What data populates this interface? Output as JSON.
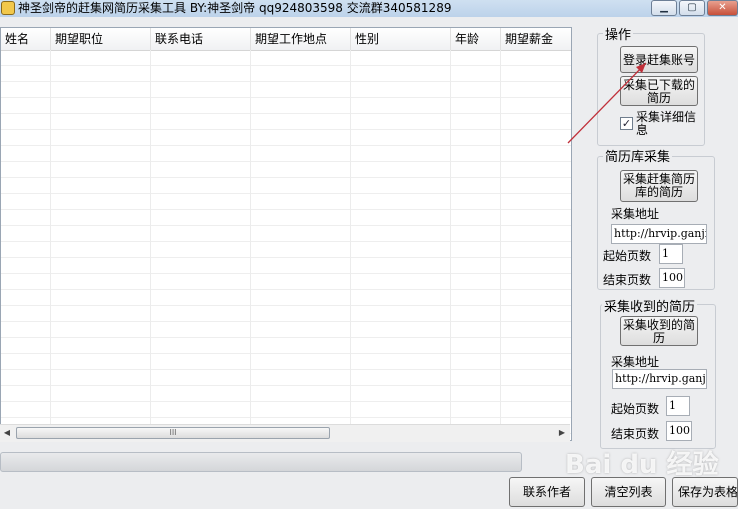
{
  "window": {
    "title": "神圣剑帝的赶集网简历采集工具 BY:神圣剑帝 qq924803598 交流群340581289",
    "controls": {
      "minimize": "▁",
      "maximize": "▢",
      "close": "✕"
    }
  },
  "grid": {
    "columns": [
      "姓名",
      "期望职位",
      "联系电话",
      "期望工作地点",
      "性别",
      "年龄",
      "期望薪金"
    ],
    "scroll_thumb_grip": "III",
    "scroll_left": "◀",
    "scroll_right": "▶"
  },
  "progress": {
    "value": 0
  },
  "panel_op": {
    "title": "操作",
    "login_button": "登录赶集账号",
    "collect_downloaded_line1": "采集已下载的",
    "collect_downloaded_line2": "简历",
    "detail_checkbox_line1": "采集详细信",
    "detail_checkbox_line2": "息",
    "detail_checked": true,
    "check_glyph": "✓"
  },
  "panel_library": {
    "title": "简历库采集",
    "collect_button_line1": "采集赶集简历",
    "collect_button_line2": "库的简历",
    "url_label": "采集地址",
    "url_value": "http://hrvip.ganji",
    "start_label": "起始页数",
    "start_value": "1",
    "end_label": "结束页数",
    "end_value": "100"
  },
  "panel_received": {
    "title": "采集收到的简历",
    "collect_button_line1": "采集收到的简",
    "collect_button_line2": "历",
    "url_label": "采集地址",
    "url_value": "http://hrvip.ganji",
    "start_label": "起始页数",
    "start_value": "1",
    "end_label": "结束页数",
    "end_value": "100"
  },
  "footer": {
    "contact_button": "联系作者",
    "clear_button": "清空列表",
    "save_button": "保存为表格"
  },
  "watermark": {
    "text": "Bai du 经验"
  },
  "colors": {
    "annotation": "#c0303a",
    "progress_fill": "#5fb35f"
  }
}
